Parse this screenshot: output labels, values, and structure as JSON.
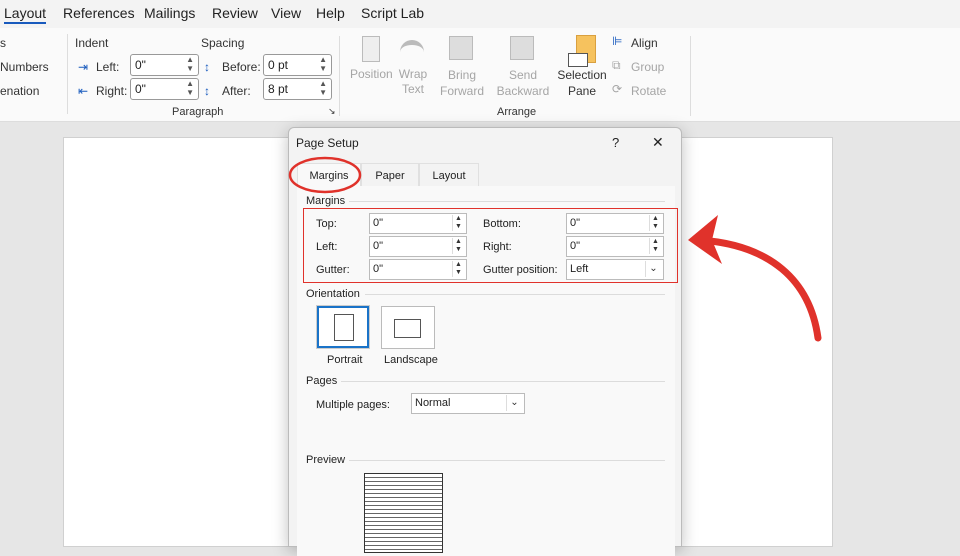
{
  "ribbon_tabs": [
    "Layout",
    "References",
    "Mailings",
    "Review",
    "View",
    "Help",
    "Script Lab"
  ],
  "left_group": {
    "items": [
      "s",
      "Numbers",
      "enation"
    ]
  },
  "paragraph": {
    "indent_label": "Indent",
    "spacing_label": "Spacing",
    "left_label": "Left:",
    "left_value": "0\"",
    "right_label": "Right:",
    "right_value": "0\"",
    "before_label": "Before:",
    "before_value": "0 pt",
    "after_label": "After:",
    "after_value": "8 pt",
    "group_label": "Paragraph"
  },
  "arrange": {
    "position": "Position",
    "wrap": [
      "Wrap",
      "Text"
    ],
    "bring": [
      "Bring",
      "Forward"
    ],
    "send": [
      "Send",
      "Backward"
    ],
    "selection": [
      "Selection",
      "Pane"
    ],
    "align": "Align",
    "group": "Group",
    "rotate": "Rotate",
    "group_label": "Arrange"
  },
  "dialog": {
    "title": "Page Setup",
    "help": "?",
    "close": "✕",
    "tabs": [
      "Margins",
      "Paper",
      "Layout"
    ],
    "margins_section": "Margins",
    "top_label": "Top:",
    "top_value": "0\"",
    "bottom_label": "Bottom:",
    "bottom_value": "0\"",
    "left_label": "Left:",
    "left_value": "0\"",
    "right_label": "Right:",
    "right_value": "0\"",
    "gutter_label": "Gutter:",
    "gutter_value": "0\"",
    "gutter_pos_label": "Gutter position:",
    "gutter_pos_value": "Left",
    "orientation_section": "Orientation",
    "portrait": "Portrait",
    "landscape": "Landscape",
    "pages_section": "Pages",
    "multiple_pages_label": "Multiple pages:",
    "multiple_pages_value": "Normal",
    "preview_section": "Preview"
  },
  "colors": {
    "annotation": "#e0322b",
    "accent": "#185abd"
  }
}
